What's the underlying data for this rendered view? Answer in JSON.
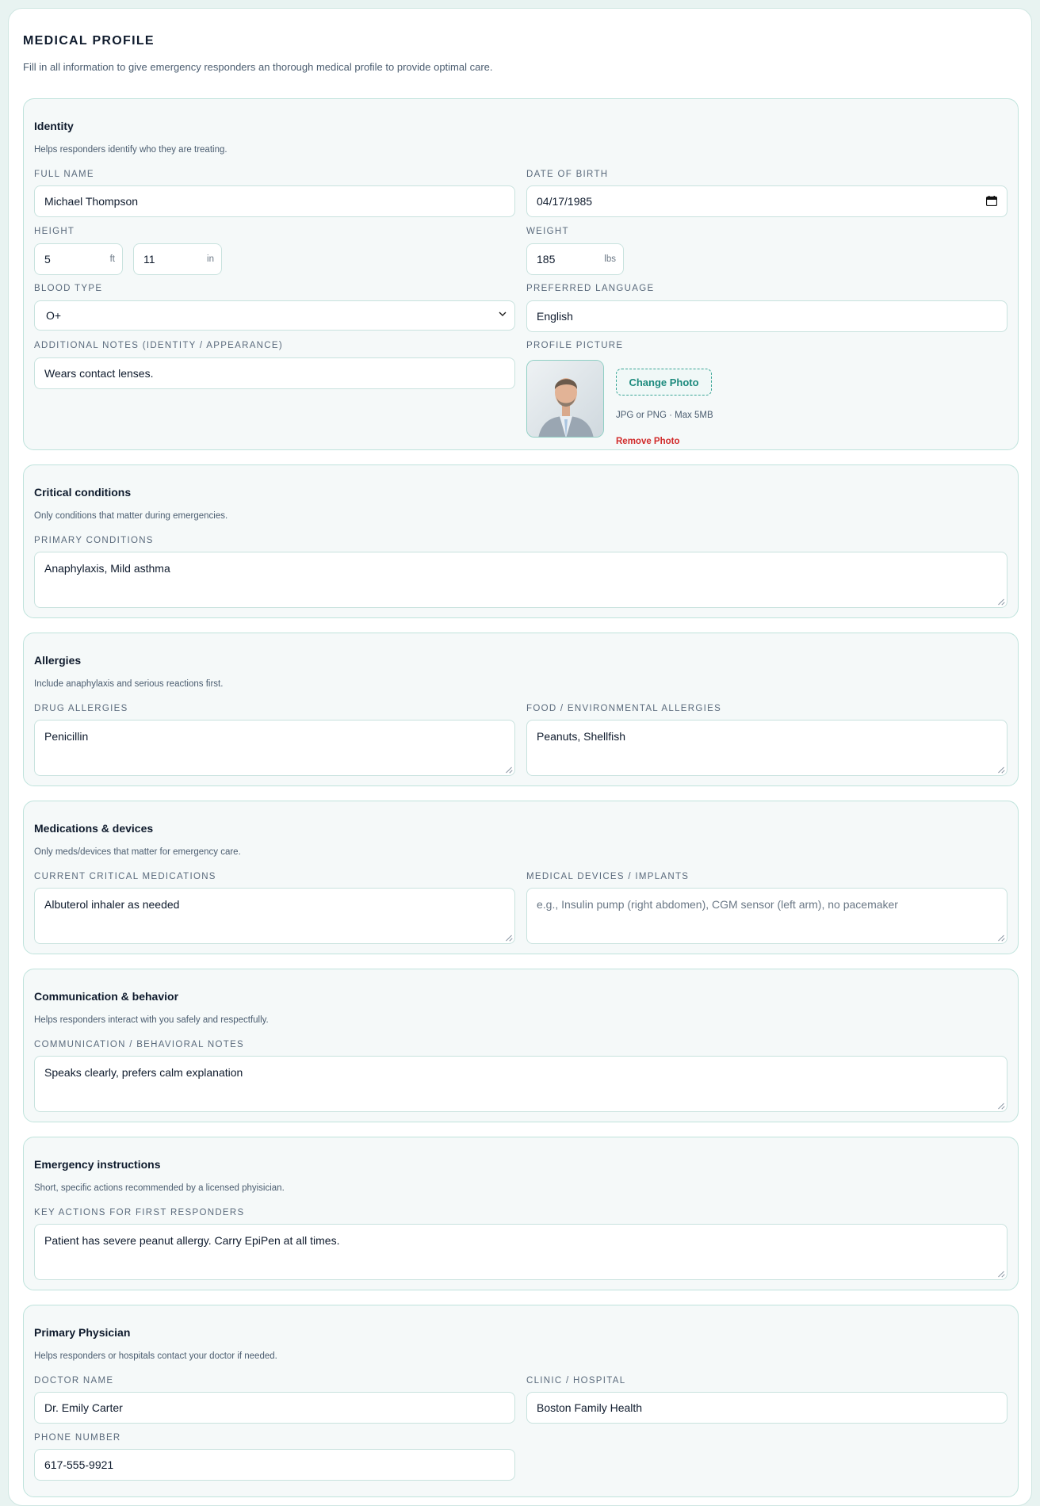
{
  "header": {
    "title": "MEDICAL PROFILE",
    "subtitle": "Fill in all information to give emergency responders an thorough medical profile to provide optimal care."
  },
  "identity": {
    "title": "Identity",
    "desc": "Helps responders identify who they are treating.",
    "full_name_label": "Full Name",
    "full_name": "Michael Thompson",
    "dob_label": "Date of Birth",
    "dob": "04/17/1985",
    "height_label": "Height",
    "height_ft": "5",
    "height_ft_unit": "ft",
    "height_in": "11",
    "height_in_unit": "in",
    "weight_label": "Weight",
    "weight": "185",
    "weight_unit": "lbs",
    "blood_type_label": "Blood Type",
    "blood_type": "O+",
    "language_label": "Preferred Language",
    "language": "English",
    "notes_label": "Additional Notes (Identity / Appearance)",
    "notes": "Wears contact lenses.",
    "picture_label": "Profile Picture",
    "change_photo": "Change Photo",
    "photo_hint": "JPG or PNG · Max 5MB",
    "remove_photo": "Remove Photo"
  },
  "critical": {
    "title": "Critical conditions",
    "desc": "Only conditions that matter during emergencies.",
    "primary_label": "Primary Conditions",
    "primary": "Anaphylaxis, Mild asthma"
  },
  "allergies": {
    "title": "Allergies",
    "desc": "Include anaphylaxis and serious reactions first.",
    "drug_label": "Drug Allergies",
    "drug": "Penicillin",
    "food_label": "Food / Environmental Allergies",
    "food": "Peanuts, Shellfish"
  },
  "medications": {
    "title": "Medications & devices",
    "desc": "Only meds/devices that matter for emergency care.",
    "current_label": "Current Critical Medications",
    "current": "Albuterol inhaler as needed",
    "devices_label": "Medical Devices / Implants",
    "devices_placeholder": "e.g., Insulin pump (right abdomen), CGM sensor (left arm), no pacemaker"
  },
  "communication": {
    "title": "Communication & behavior",
    "desc": "Helps responders interact with you safely and respectfully.",
    "notes_label": "Communication / Behavioral Notes",
    "notes": "Speaks clearly, prefers calm explanation"
  },
  "emergency": {
    "title": "Emergency instructions",
    "desc": "Short, specific actions recommended by a licensed phyisician.",
    "actions_label": "Key Actions for First Responders",
    "actions": "Patient has severe peanut allergy. Carry EpiPen at all times."
  },
  "physician": {
    "title": "Primary Physician",
    "desc": "Helps responders or hospitals contact your doctor if needed.",
    "doctor_label": "Doctor Name",
    "doctor": "Dr. Emily Carter",
    "clinic_label": "Clinic / Hospital",
    "clinic": "Boston Family Health",
    "phone_label": "Phone Number",
    "phone": "617-555-9921"
  }
}
